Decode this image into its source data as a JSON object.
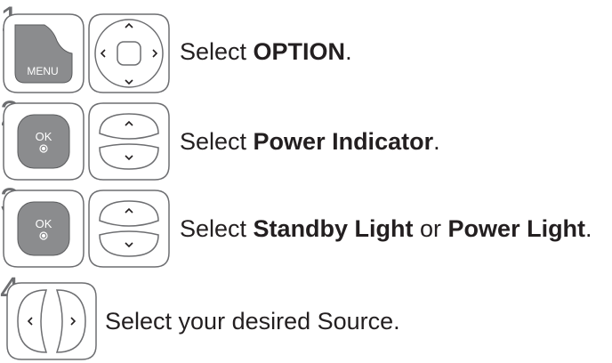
{
  "steps": [
    {
      "number": "1",
      "buttons": [
        "MENU"
      ],
      "instruction": {
        "prefix": "Select ",
        "bold1": "OPTION",
        "middle": "",
        "bold2": "",
        "suffix": "."
      }
    },
    {
      "number": "2",
      "buttons": [
        "OK"
      ],
      "instruction": {
        "prefix": "Select ",
        "bold1": "Power Indicator",
        "middle": "",
        "bold2": "",
        "suffix": "."
      }
    },
    {
      "number": "3",
      "buttons": [
        "OK"
      ],
      "instruction": {
        "prefix": "Select ",
        "bold1": "Standby Light",
        "middle": " or ",
        "bold2": "Power Light",
        "suffix": "."
      }
    },
    {
      "number": "4",
      "buttons": [],
      "instruction": {
        "prefix": "Select your desired Source.",
        "bold1": "",
        "middle": "",
        "bold2": "",
        "suffix": ""
      }
    }
  ],
  "icons": {
    "step1": [
      "menu-button-icon",
      "navigation-pad-icon"
    ],
    "step2": [
      "ok-button-icon",
      "up-down-rocker-icon"
    ],
    "step3": [
      "ok-button-icon",
      "up-down-rocker-icon"
    ],
    "step4": [
      "left-right-rocker-icon"
    ]
  },
  "colors": {
    "button_fill": "#8b8c8e",
    "outline": "#6d6e71",
    "text": "#231f20"
  }
}
